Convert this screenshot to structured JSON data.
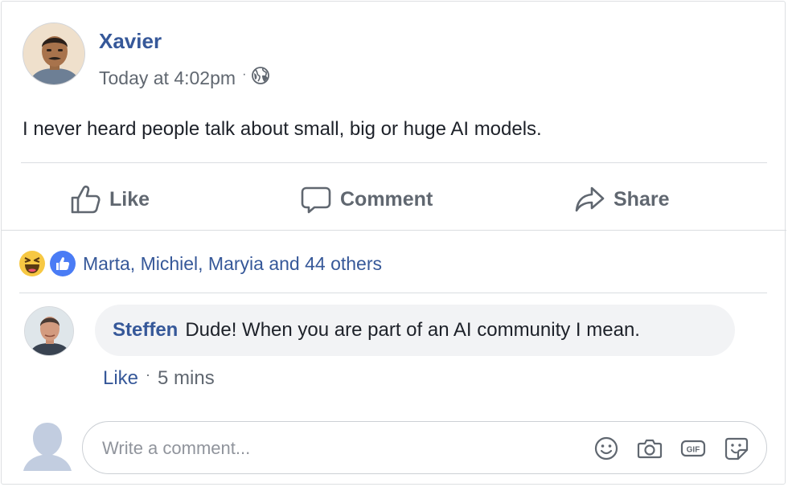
{
  "post": {
    "author": "Xavier",
    "timestamp": "Today at 4:02pm",
    "privacy_icon": "globe-icon",
    "text": "I never heard people talk about small, big or huge AI models."
  },
  "actions": {
    "like": "Like",
    "comment": "Comment",
    "share": "Share"
  },
  "reactions": {
    "icons": [
      "haha-emoji-icon",
      "like-reaction-icon"
    ],
    "summary": "Marta, Michiel, Maryia and 44 others"
  },
  "comments": [
    {
      "author": "Steffen",
      "text": "Dude! When you are part of an AI community I mean.",
      "like_label": "Like",
      "time": "5 mins"
    }
  ],
  "composer": {
    "placeholder": "Write a comment...",
    "icons": [
      "emoji-icon",
      "camera-icon",
      "gif-icon",
      "sticker-icon"
    ]
  },
  "colors": {
    "link_blue": "#365899",
    "text_dark": "#1d2129",
    "text_gray": "#606770",
    "bubble_bg": "#f2f3f5",
    "like_blue": "#4a7cf5",
    "haha_yellow": "#f7c843"
  }
}
